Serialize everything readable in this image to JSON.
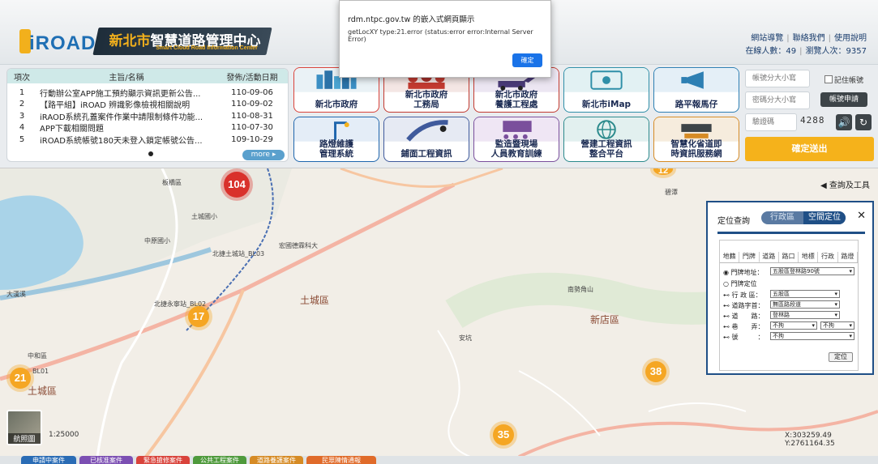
{
  "header": {
    "logo_text": "iROAD",
    "title": "新北市智慧道路管理中心",
    "title_main": "新北市",
    "title_rest": "智慧道路管理中心",
    "subtitle": "Smart Cloud Road Information Center",
    "links": [
      "網站導覽",
      "聯絡我們",
      "使用說明"
    ],
    "online_label": "在線人數：49",
    "visits_label": "瀏覽人次：9357"
  },
  "news": {
    "headers": [
      "項次",
      "主旨/名稱",
      "發佈/活動日期"
    ],
    "rows": [
      {
        "no": "1",
        "title": "行動辦公室APP施工預約顯示資訊更新公告...",
        "date": "110-09-06"
      },
      {
        "no": "2",
        "title": "【路平組】iROAD 辨識影像檢視相關說明",
        "date": "110-09-02"
      },
      {
        "no": "3",
        "title": "iRAOD系統孔蓋案件作業中請限制條件功能...",
        "date": "110-08-31"
      },
      {
        "no": "4",
        "title": "APP下載相關問題",
        "date": "110-07-30"
      },
      {
        "no": "5",
        "title": "iROAD系統帳號180天未登入鎖定帳號公告...",
        "date": "109-10-29"
      }
    ],
    "more_label": "more ▸"
  },
  "tiles": [
    {
      "label": "新北市政府",
      "color": "#d9433b"
    },
    {
      "label": "新北市政府\n工務局",
      "color": "#c23a30"
    },
    {
      "label": "新北市政府\n養護工程處",
      "color": "#c23a30"
    },
    {
      "label": "新北市iMap",
      "color": "#2f8fa8"
    },
    {
      "label": "路平報馬仔",
      "color": "#2d7fb3"
    },
    {
      "label": "路燈維護\n管理系統",
      "color": "#1f66ad"
    },
    {
      "label": "鋪面工程資訊",
      "color": "#3f5a9c"
    },
    {
      "label": "監造暨現場\n人員教育訓練",
      "color": "#7a4f9c"
    },
    {
      "label": "營建工程資訊\n整合平台",
      "color": "#2b8a8c"
    },
    {
      "label": "智慧化省道即\n時資訊服務網",
      "color": "#d68b25"
    }
  ],
  "login": {
    "account_placeholder": "帳號分大小寫",
    "password_placeholder": "密碼分大小寫",
    "captcha_placeholder": "驗證碼",
    "captcha_code": "4288",
    "remember_label": "記住帳號",
    "apply_label": "帳號申請",
    "submit_label": "確定送出"
  },
  "map": {
    "tools_label": "◀ 查詢及工具",
    "aerial_label": "航照圖",
    "scale_label": "1:25000",
    "coord_label": "X:303259.49 Y:2761164.35",
    "districts": [
      "土城區",
      "新店區",
      "土城區"
    ],
    "clusters": [
      "104",
      "17",
      "21",
      "38",
      "35",
      "12"
    ],
    "place_labels": [
      "板橋區",
      "大漢溪",
      "中原國小",
      "土城國小",
      "北捷土城站_BL03",
      "北捷永寧站_BL02",
      "BL01",
      "安坑",
      "南勢角山",
      "宏國德霖科大",
      "中和區",
      "碧潭"
    ]
  },
  "locate": {
    "title": "定位查詢",
    "seg_tabs": [
      "行政區",
      "空間定位"
    ],
    "close": "✕",
    "inner_tabs": [
      "地籍",
      "門牌",
      "道路",
      "路口",
      "地標",
      "行政",
      "路燈"
    ],
    "radio1": "門牌地址：",
    "address_value": "五股區登林路90號",
    "radio2": "門牌定位",
    "fields": [
      {
        "label": "行 政 區：",
        "value": "五股區"
      },
      {
        "label": "道路字首：",
        "value": "無區路段道"
      },
      {
        "label": "道　　路：",
        "value": "登林路"
      },
      {
        "label": "巷　　弄：",
        "value": "不拘"
      },
      {
        "label": "號　　　：",
        "value": "不拘"
      }
    ],
    "extra_value": "不拘",
    "locate_button": "定位"
  },
  "bottom_tabs": [
    {
      "label": "申請中案件",
      "color": "#2a6cb5"
    },
    {
      "label": "已核准案件",
      "color": "#7c4fb3"
    },
    {
      "label": "緊急搶修案件",
      "color": "#d9433b"
    },
    {
      "label": "公共工程案件",
      "color": "#4f9a3c"
    },
    {
      "label": "道路養護案件",
      "color": "#d68b25"
    },
    {
      "label": "民眾陳情通報",
      "color": "#e06b2a"
    }
  ],
  "alert": {
    "title": "rdm.ntpc.gov.tw 的嵌入式網頁顯示",
    "message": "getLocXY type:21.error (status:error error:Internal Server Error)",
    "ok_label": "確定"
  }
}
